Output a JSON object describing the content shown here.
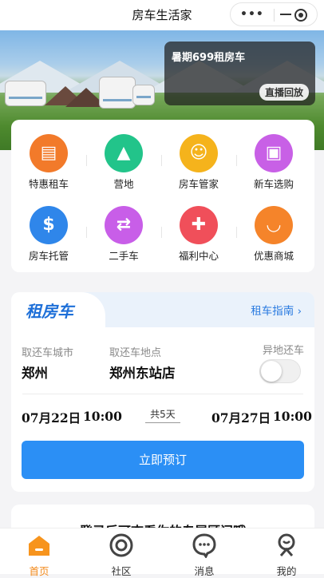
{
  "topbar": {
    "title": "房车生活家",
    "more_icon": "more-dots-icon",
    "minimize_icon": "minimize-icon",
    "close_icon": "target-close-icon"
  },
  "banner": {
    "promo_title": "暑期699租房车",
    "promo_button": "直播回放"
  },
  "services": [
    {
      "label": "特惠租车",
      "icon": "coupon-doc-icon",
      "color": "#f27a2a"
    },
    {
      "label": "营地",
      "icon": "tent-icon",
      "color": "#22c48a"
    },
    {
      "label": "房车管家",
      "icon": "butler-icon",
      "color": "#f5b31c"
    },
    {
      "label": "新车选购",
      "icon": "rv-icon",
      "color": "#c860e6"
    },
    {
      "label": "房车托管",
      "icon": "hand-coin-icon",
      "color": "#2f86ea"
    },
    {
      "label": "二手车",
      "icon": "exchange-icon",
      "color": "#c85ee8"
    },
    {
      "label": "福利中心",
      "icon": "gift-icon",
      "color": "#f04f5a"
    },
    {
      "label": "优惠商城",
      "icon": "shopping-bag-icon",
      "color": "#f5842a"
    }
  ],
  "rent": {
    "tab_label": "租房车",
    "guide_label": "租车指南 ›",
    "city_label": "取还车城市",
    "city_value": "郑州",
    "location_label": "取还车地点",
    "location_value": "郑州东站店",
    "return_label": "异地还车",
    "return_enabled": false,
    "pickup_date": "07月22日",
    "pickup_time": "10:00",
    "days": "共5天",
    "return_date": "07月27日",
    "return_time": "10:00",
    "book_label": "立即预订"
  },
  "tip": {
    "text": "登录后可查看你的专属顾问哦"
  },
  "tabbar": [
    {
      "label": "首页",
      "icon": "home-icon",
      "active": true
    },
    {
      "label": "社区",
      "icon": "community-icon",
      "active": false
    },
    {
      "label": "消息",
      "icon": "message-icon",
      "active": false
    },
    {
      "label": "我的",
      "icon": "profile-icon",
      "active": false
    }
  ],
  "colors": {
    "accent": "#2b8ff5",
    "active_tab": "#f28a1c"
  }
}
